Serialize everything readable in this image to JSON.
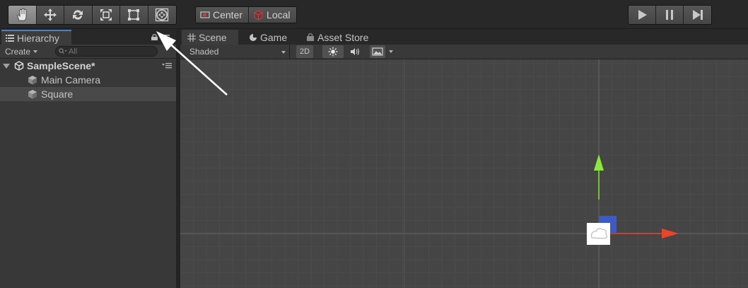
{
  "toolbar": {
    "tools": [
      "hand-tool",
      "move-tool",
      "rotate-tool",
      "scale-tool",
      "rect-tool",
      "transform-tool"
    ],
    "active_tool": "hand-tool",
    "pivot_label": "Center",
    "space_label": "Local",
    "play_controls": [
      "play",
      "pause",
      "step"
    ]
  },
  "hierarchy": {
    "tab_label": "Hierarchy",
    "create_label": "Create",
    "search_placeholder": "All",
    "scene_name": "SampleScene*",
    "items": [
      {
        "label": "Main Camera",
        "selected": false
      },
      {
        "label": "Square",
        "selected": true
      }
    ]
  },
  "scene_view": {
    "tabs": [
      {
        "label": "Scene",
        "active": true
      },
      {
        "label": "Game",
        "active": false
      },
      {
        "label": "Asset Store",
        "active": false
      }
    ],
    "shading_mode": "Shaded",
    "mode_2d_label": "2D"
  },
  "colors": {
    "gizmo_y": "#8ce63c",
    "gizmo_x": "#e8462a",
    "gizmo_z": "#3c5ac8",
    "selection_tab": "#4e80c4"
  }
}
